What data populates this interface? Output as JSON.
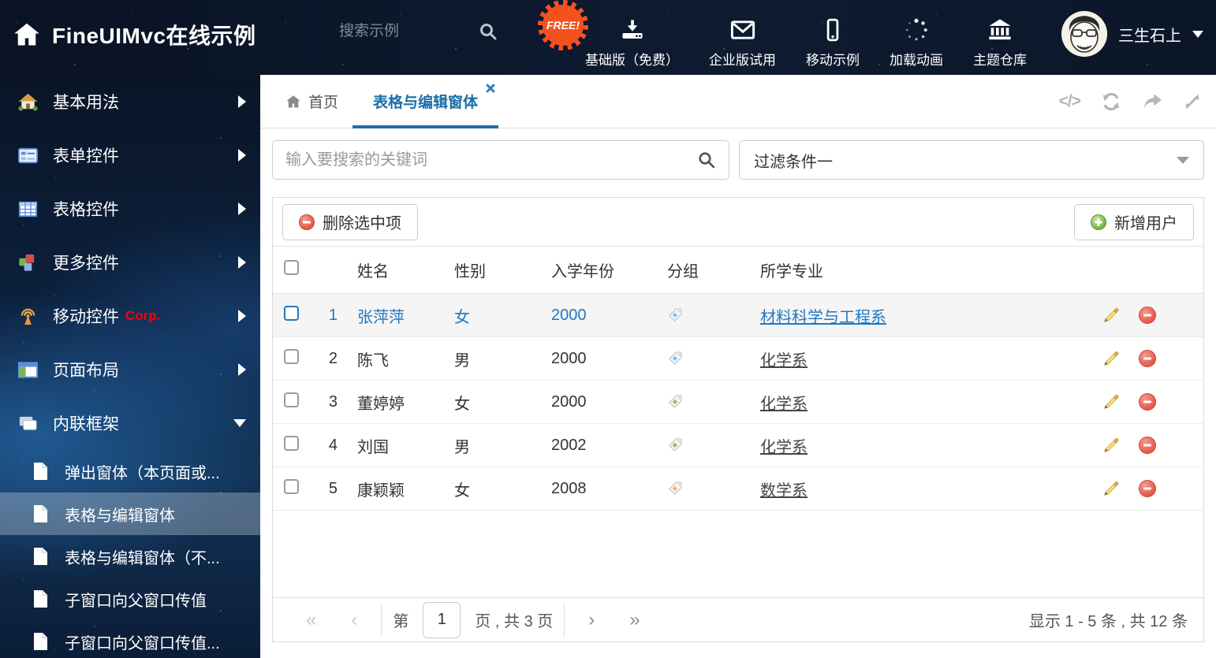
{
  "colors": {
    "accent_blue": "#1b6ea9",
    "row_active_blue": "#1f78c1",
    "corp_red": "#ff0000",
    "free_orange": "#f4511e",
    "tag_blue": "#7fc3ee",
    "tag_green": "#90c064",
    "tag_orange": "#f5b06a"
  },
  "header": {
    "title": "FineUIMvc在线示例",
    "search_placeholder": "搜索示例",
    "free_badge": "FREE!",
    "nav": [
      {
        "icon": "download-icon",
        "label": "基础版（免费）"
      },
      {
        "icon": "envelope-icon",
        "label": "企业版试用"
      },
      {
        "icon": "mobile-icon",
        "label": "移动示例"
      },
      {
        "icon": "spinner-icon",
        "label": "加载动画"
      },
      {
        "icon": "bank-icon",
        "label": "主题仓库"
      }
    ],
    "user": {
      "name": "三生石上"
    }
  },
  "sidebar": {
    "items": [
      {
        "label": "基本用法"
      },
      {
        "label": "表单控件"
      },
      {
        "label": "表格控件"
      },
      {
        "label": "更多控件"
      },
      {
        "label": "移动控件",
        "badge": "Corp."
      },
      {
        "label": "页面布局"
      },
      {
        "label": "内联框架"
      }
    ],
    "subitems": [
      {
        "label": "弹出窗体（本页面或..."
      },
      {
        "label": "表格与编辑窗体"
      },
      {
        "label": "表格与编辑窗体（不..."
      },
      {
        "label": "子窗口向父窗口传值"
      },
      {
        "label": "子窗口向父窗口传值..."
      }
    ]
  },
  "tabs": {
    "home": "首页",
    "current": "表格与编辑窗体",
    "code_icon": "</>"
  },
  "toolbar": {
    "search_placeholder": "输入要搜索的关键词",
    "filter_value": "过滤条件一",
    "delete_button": "删除选中项",
    "add_button": "新增用户"
  },
  "table": {
    "columns": {
      "name": "姓名",
      "gender": "性别",
      "year": "入学年份",
      "group": "分组",
      "major": "所学专业"
    },
    "rows": [
      {
        "index": "1",
        "name": "张萍萍",
        "gender": "女",
        "year": "2000",
        "tag_hex": "#7fc3ee",
        "major": "材料科学与工程系"
      },
      {
        "index": "2",
        "name": "陈飞",
        "gender": "男",
        "year": "2000",
        "tag_hex": "#7fc3ee",
        "major": "化学系"
      },
      {
        "index": "3",
        "name": "董婷婷",
        "gender": "女",
        "year": "2000",
        "tag_hex": "#90c064",
        "major": "化学系"
      },
      {
        "index": "4",
        "name": "刘国",
        "gender": "男",
        "year": "2002",
        "tag_hex": "#90c064",
        "major": "化学系"
      },
      {
        "index": "5",
        "name": "康颖颖",
        "gender": "女",
        "year": "2008",
        "tag_hex": "#f5b06a",
        "major": "数学系"
      }
    ]
  },
  "pagination": {
    "first": "«",
    "prev": "‹",
    "next": "›",
    "last": "»",
    "page_prefix": "第",
    "current_page": "1",
    "page_suffix": "页 , 共 3 页",
    "summary": "显示 1 - 5 条 , 共 12 条"
  }
}
